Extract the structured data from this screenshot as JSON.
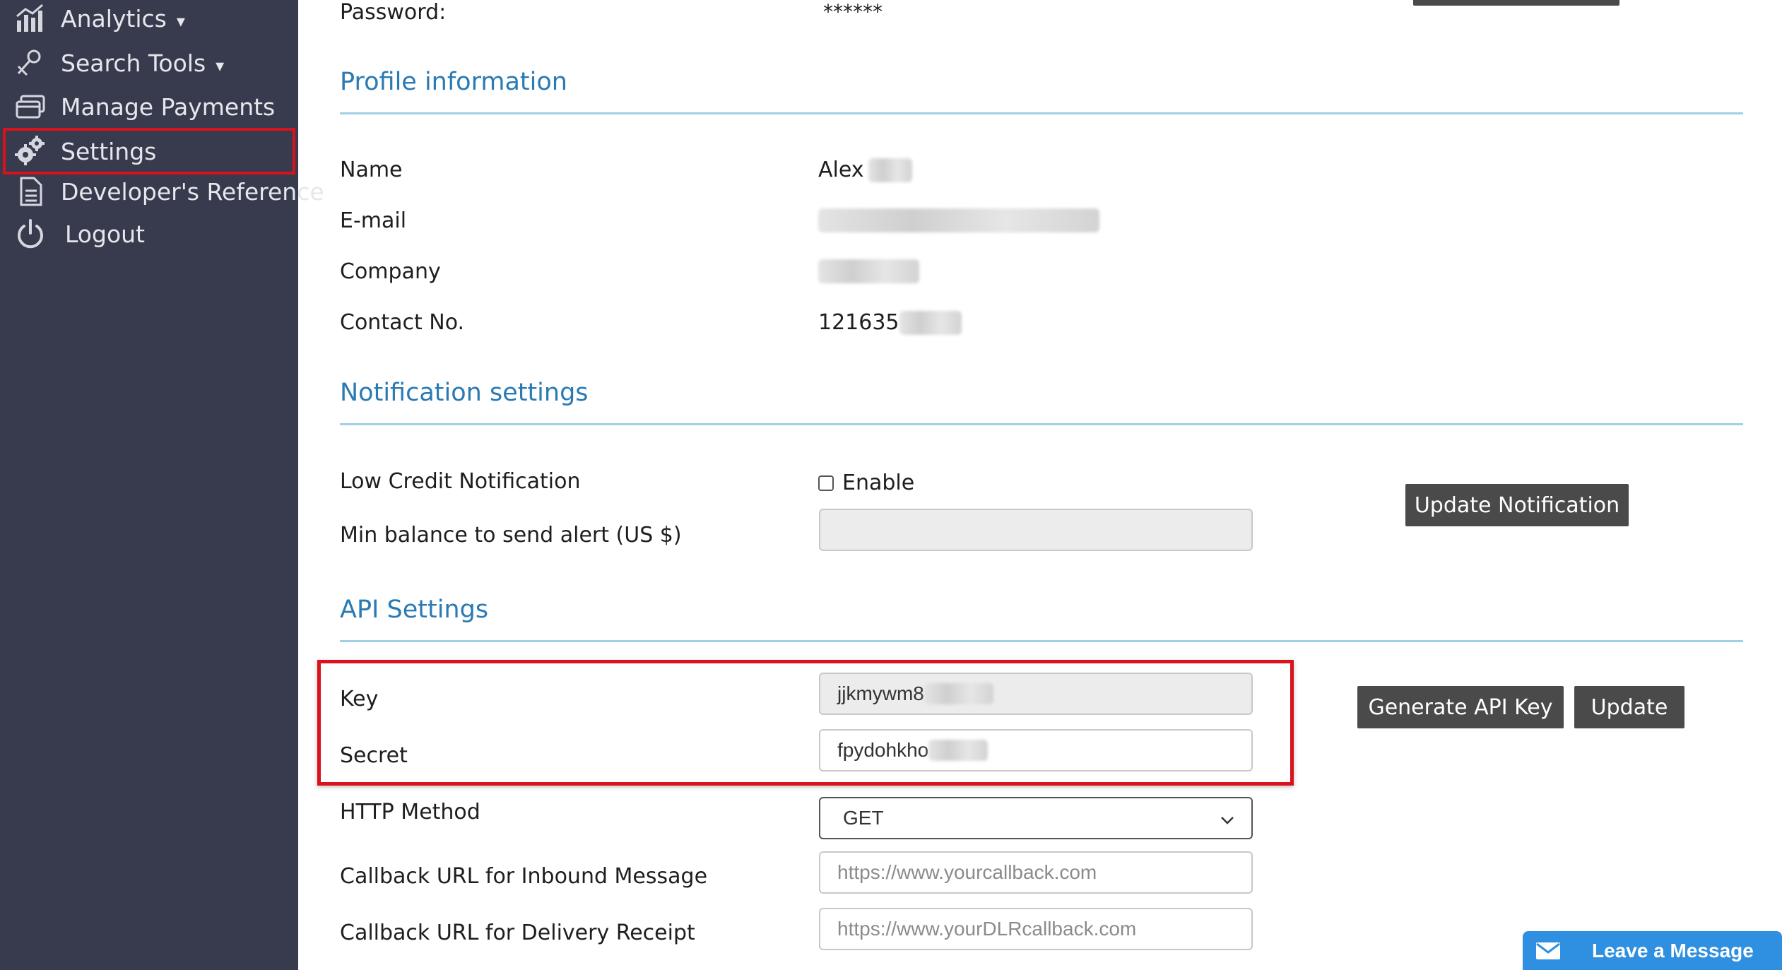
{
  "sidebar": {
    "items": [
      {
        "label": "Analytics",
        "caret": "▾",
        "icon": "analytics-chart-icon"
      },
      {
        "label": "Search Tools",
        "caret": "▾",
        "icon": "search-tools-icon"
      },
      {
        "label": "Manage Payments",
        "icon": "payments-card-icon"
      },
      {
        "label": "Settings",
        "icon": "gears-icon"
      },
      {
        "label": "Developer's Reference",
        "icon": "document-icon"
      },
      {
        "label": "Logout",
        "icon": "power-icon"
      }
    ]
  },
  "account": {
    "password_label": "Password:",
    "password_value": "******"
  },
  "profile": {
    "title": "Profile information",
    "name_label": "Name",
    "name_value": "Alex",
    "email_label": "E-mail",
    "company_label": "Company",
    "contact_label": "Contact No.",
    "contact_value": "121635"
  },
  "notification": {
    "title": "Notification settings",
    "low_credit_label": "Low Credit Notification",
    "enable_label": "Enable",
    "min_balance_label": "Min balance to send alert (US $)",
    "update_button": "Update Notification"
  },
  "api": {
    "title": "API Settings",
    "key_label": "Key",
    "key_value": "jjkmywm8",
    "secret_label": "Secret",
    "secret_value": "fpydohkho",
    "http_method_label": "HTTP Method",
    "http_method_value": "GET",
    "inbound_label": "Callback URL for Inbound Message",
    "inbound_placeholder": "https://www.yourcallback.com",
    "dlr_label": "Callback URL for Delivery Receipt",
    "dlr_placeholder": "https://www.yourDLRcallback.com",
    "generate_button": "Generate API Key",
    "update_button": "Update"
  },
  "chat": {
    "label": "Leave a Message"
  },
  "colors": {
    "sidebar_bg": "#383b4e",
    "accent_blue": "#2a7ab4",
    "highlight_red": "#d9121b",
    "button_dark": "#4a4a4a",
    "chat_blue": "#2f8fe0"
  }
}
